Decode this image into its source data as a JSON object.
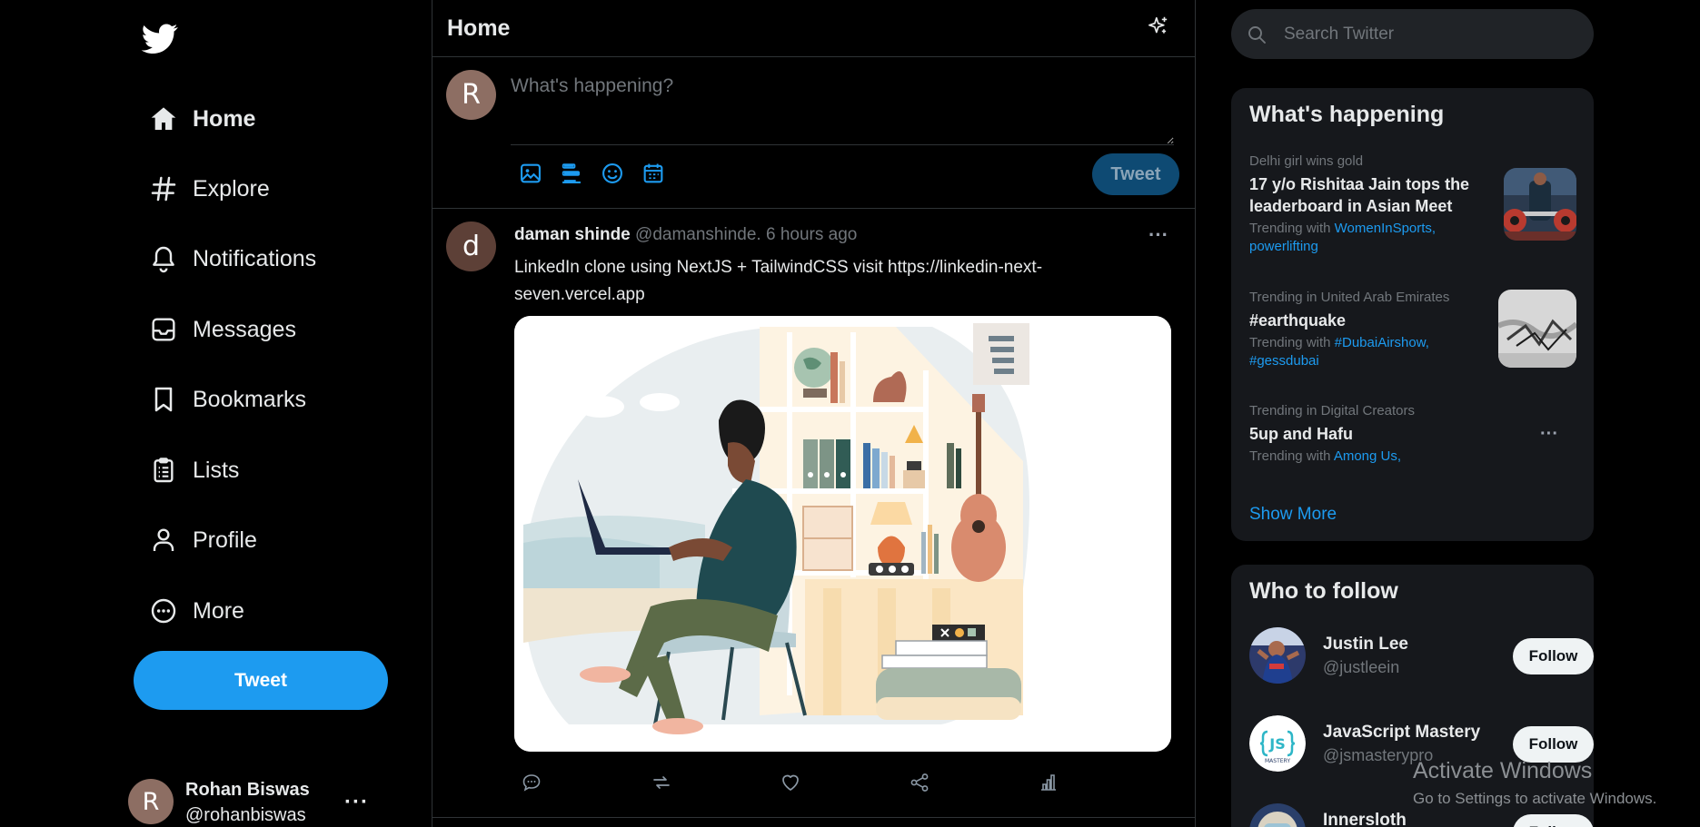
{
  "colors": {
    "accent": "#1d9bf0",
    "background": "#000000",
    "card": "#16181c",
    "muted": "#71767b"
  },
  "sidebar": {
    "logo_icon": "twitter-bird-icon",
    "items": [
      {
        "label": "Home",
        "icon": "home-icon",
        "active": true
      },
      {
        "label": "Explore",
        "icon": "hashtag-icon"
      },
      {
        "label": "Notifications",
        "icon": "bell-icon"
      },
      {
        "label": "Messages",
        "icon": "inbox-icon"
      },
      {
        "label": "Bookmarks",
        "icon": "bookmark-icon"
      },
      {
        "label": "Lists",
        "icon": "clipboard-list-icon"
      },
      {
        "label": "Profile",
        "icon": "person-icon"
      },
      {
        "label": "More",
        "icon": "more-circle-icon"
      }
    ],
    "tweet_button": "Tweet",
    "account": {
      "avatar_letter": "R",
      "name": "Rohan Biswas",
      "handle": "@rohanbiswas",
      "more": "···"
    }
  },
  "main": {
    "title": "Home",
    "composer": {
      "avatar_letter": "R",
      "placeholder": "What's happening?",
      "tweet_button": "Tweet",
      "tools": [
        "image-icon",
        "poll-icon",
        "emoji-icon",
        "schedule-icon"
      ]
    },
    "post": {
      "avatar_letter": "d",
      "author": "daman shinde",
      "handle": "@damanshinde.",
      "time": "6 hours ago",
      "more": "···",
      "text": "LinkedIn clone using NextJS + TailwindCSS visit https://linkedin-next-seven.vercel.app",
      "actions": [
        "reply-icon",
        "retweet-icon",
        "like-icon",
        "share-icon",
        "analytics-icon"
      ]
    }
  },
  "right": {
    "search_placeholder": "Search Twitter",
    "trends": {
      "title": "What's happening",
      "items": [
        {
          "context": "Delhi girl wins gold",
          "title": "17 y/o Rishitaa Jain tops the leaderboard in Asian Meet",
          "with_prefix": "Trending with ",
          "tags": "WomenInSports, powerlifting"
        },
        {
          "context": "Trending in United Arab Emirates",
          "title": "#earthquake",
          "with_prefix": "Trending with ",
          "tags": "#DubaiAirshow, #gessdubai"
        },
        {
          "context": "Trending in Digital Creators",
          "title": "5up and Hafu",
          "with_prefix": "Trending with ",
          "tags": "Among Us,"
        }
      ],
      "more": "···",
      "show_more": "Show More"
    },
    "follow": {
      "title": "Who to follow",
      "users": [
        {
          "name": "Justin Lee",
          "handle": "@justleein",
          "button": "Follow"
        },
        {
          "name": "JavaScript Mastery",
          "handle": "@jsmasterypro",
          "button": "Follow"
        },
        {
          "name": "Innersloth",
          "handle": "",
          "button": "Follow"
        }
      ]
    }
  },
  "watermark": {
    "title": "Activate Windows",
    "subtitle": "Go to Settings to activate Windows."
  }
}
